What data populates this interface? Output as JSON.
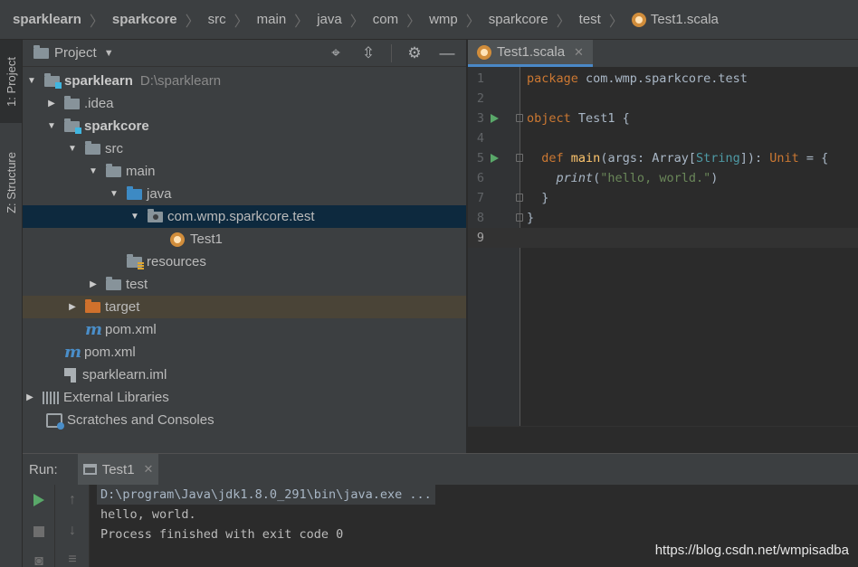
{
  "breadcrumb": {
    "items": [
      "sparklearn",
      "sparkcore",
      "src",
      "main",
      "java",
      "com",
      "wmp",
      "sparkcore",
      "test"
    ],
    "file": "Test1.scala"
  },
  "stripe": {
    "project_tab": "1: Project",
    "structure_tab": "Z: Structure"
  },
  "project_panel": {
    "title": "Project",
    "tree": [
      {
        "label": "sparklearn",
        "path": "D:\\sparklearn"
      },
      {
        "label": ".idea"
      },
      {
        "label": "sparkcore"
      },
      {
        "label": "src"
      },
      {
        "label": "main"
      },
      {
        "label": "java"
      },
      {
        "label": "com.wmp.sparkcore.test"
      },
      {
        "label": "Test1"
      },
      {
        "label": "resources"
      },
      {
        "label": "test"
      },
      {
        "label": "target"
      },
      {
        "label": "pom.xml"
      },
      {
        "label": "pom.xml"
      },
      {
        "label": "sparklearn.iml"
      },
      {
        "label": "External Libraries"
      },
      {
        "label": "Scratches and Consoles"
      }
    ]
  },
  "editor": {
    "tab_label": "Test1.scala",
    "line_numbers": [
      "1",
      "2",
      "3",
      "4",
      "5",
      "6",
      "7",
      "8",
      "9"
    ],
    "code": {
      "l1_kw": "package",
      "l1_rest": " com.wmp.sparkcore.test",
      "l3_kw": "object",
      "l3_rest": " Test1 {",
      "l5_kw": "def",
      "l5_fn": "main",
      "l5_a": "(args: Array[",
      "l5_ty": "String",
      "l5_b": "]): ",
      "l5_kw2": "Unit",
      "l5_c": " = {",
      "l6_fn": "print",
      "l6_open": "(",
      "l6_str": "\"hello, world.\"",
      "l6_close": ")",
      "l7": "}",
      "l8": "}"
    }
  },
  "run_panel": {
    "title": "Run:",
    "tab_label": "Test1",
    "console_lines": [
      "D:\\program\\Java\\jdk1.8.0_291\\bin\\java.exe ...",
      "hello, world.",
      "Process finished with exit code 0"
    ]
  },
  "watermark": "https://blog.csdn.net/wmpisadba",
  "colors": {
    "background": "#2b2b2b",
    "panel": "#3c3f41",
    "selection": "#0d293e",
    "excluded": "#4a4437",
    "accent": "#4a88c7",
    "run_green": "#59a869",
    "keyword": "#cc7832",
    "string": "#6a8759",
    "function": "#ffc66d"
  },
  "icons": [
    "folder-icon",
    "module-icon",
    "package-icon",
    "scala-object-icon",
    "maven-icon",
    "file-icon",
    "library-icon",
    "scratch-icon",
    "run-icon",
    "stop-icon",
    "gear-icon",
    "target-icon",
    "collapse-icon",
    "minimize-icon"
  ]
}
